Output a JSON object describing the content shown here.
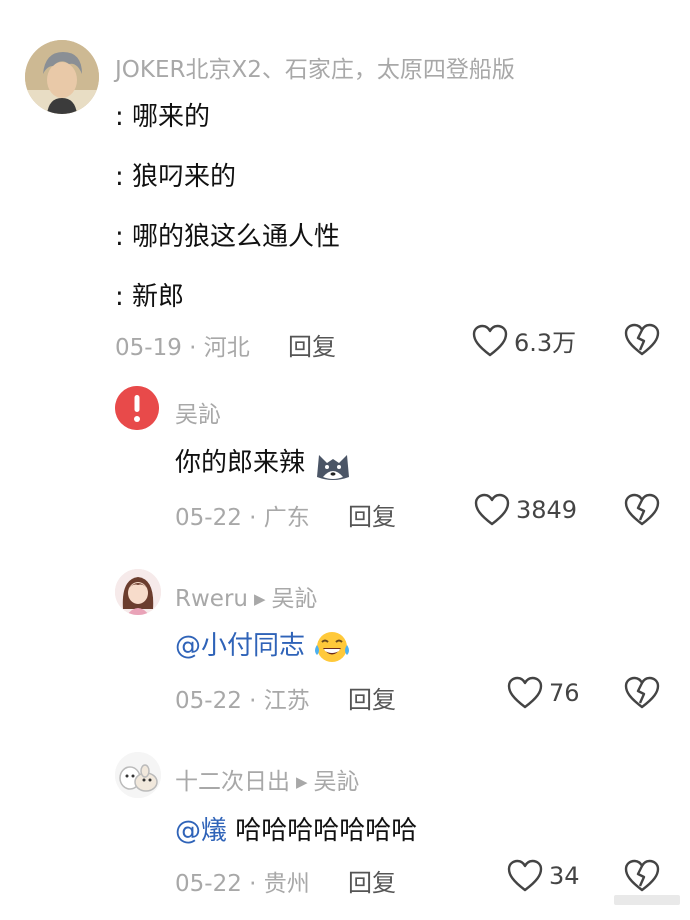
{
  "comments": [
    {
      "username": "JOKER北京X2、石家庄，太原四登船版",
      "lines": [
        ": 哪来的",
        ": 狼叼来的",
        ": 哪的狼这么通人性",
        ": 新郎"
      ],
      "date": "05-19",
      "location": "河北",
      "reply_label": "回复",
      "likes": "6.3万"
    },
    {
      "username": "吴訫",
      "text": "你的郎来辣",
      "text_emoji": "wolf-emoji",
      "date": "05-22",
      "location": "广东",
      "reply_label": "回复",
      "likes": "3849"
    },
    {
      "username": "Rweru",
      "reply_to": "吴訫",
      "mention": "@小付同志",
      "text_emoji": "laughing-crying-emoji",
      "date": "05-22",
      "location": "江苏",
      "reply_label": "回复",
      "likes": "76"
    },
    {
      "username": "十二次日出",
      "reply_to": "吴訫",
      "mention": "@燨",
      "text": " 哈哈哈哈哈哈哈",
      "date": "05-22",
      "location": "贵州",
      "reply_label": "回复",
      "likes": "34"
    }
  ],
  "meta_separator": " · ",
  "colors": {
    "mention": "#2f63b8",
    "muted": "#a8a8a8",
    "alert_red": "#e84a4a"
  }
}
